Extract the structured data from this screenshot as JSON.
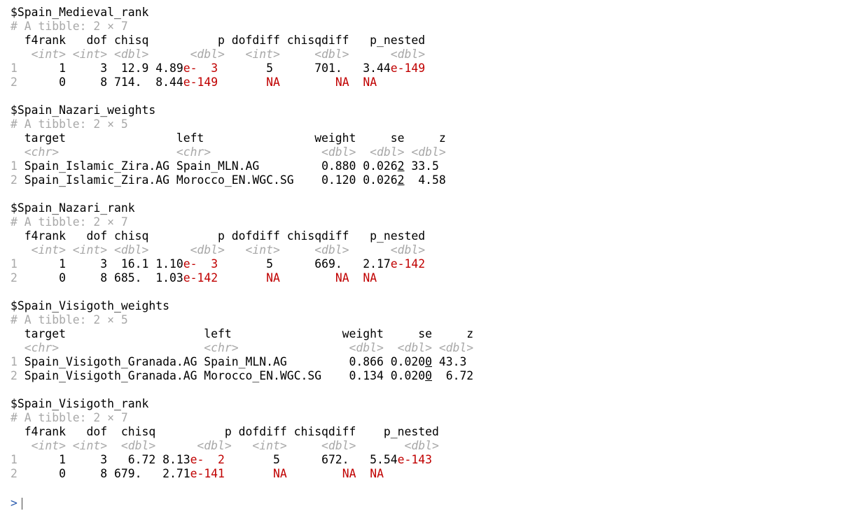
{
  "console": {
    "lines": [
      [
        {
          "t": "$Spain_Medieval_rank",
          "k": "text"
        }
      ],
      [
        {
          "t": "# A tibble: 2 × 7",
          "k": "comment"
        }
      ],
      [
        {
          "t": "  f4rank   dof chisq          p dofdiff chisqdiff   p_nested",
          "k": "text"
        }
      ],
      [
        {
          "t": "   <int> <int> <dbl>      <dbl>   <int>     <dbl>      <dbl>",
          "k": "type"
        }
      ],
      [
        {
          "t": "1",
          "k": "rownum"
        },
        {
          "t": "      1     3  12.9 4.89",
          "k": "text"
        },
        {
          "t": "e-  3",
          "k": "red"
        },
        {
          "t": "       5      701.   3.44",
          "k": "text"
        },
        {
          "t": "e-149",
          "k": "red"
        }
      ],
      [
        {
          "t": "2",
          "k": "rownum"
        },
        {
          "t": "      0     8 714.  8.44",
          "k": "text"
        },
        {
          "t": "e-149",
          "k": "red"
        },
        {
          "t": "       ",
          "k": "text"
        },
        {
          "t": "NA",
          "k": "red"
        },
        {
          "t": "        ",
          "k": "text"
        },
        {
          "t": "NA",
          "k": "red"
        },
        {
          "t": "  ",
          "k": "text"
        },
        {
          "t": "NA",
          "k": "red"
        }
      ],
      [
        {
          "t": "",
          "k": "text"
        }
      ],
      [
        {
          "t": "$Spain_Nazari_weights",
          "k": "text"
        }
      ],
      [
        {
          "t": "# A tibble: 2 × 5",
          "k": "comment"
        }
      ],
      [
        {
          "t": "  target                left                weight     se     z",
          "k": "text"
        }
      ],
      [
        {
          "t": "  <chr>                 <chr>                <dbl>  <dbl> <dbl>",
          "k": "type"
        }
      ],
      [
        {
          "t": "1",
          "k": "rownum"
        },
        {
          "t": " Spain_Islamic_Zira.AG Spain_MLN.AG         0.880 0.026",
          "k": "text"
        },
        {
          "t": "2",
          "k": "under"
        },
        {
          "t": " 33.5",
          "k": "text"
        }
      ],
      [
        {
          "t": "2",
          "k": "rownum"
        },
        {
          "t": " Spain_Islamic_Zira.AG Morocco_EN.WGC.SG    0.120 0.026",
          "k": "text"
        },
        {
          "t": "2",
          "k": "under"
        },
        {
          "t": "  4.58",
          "k": "text"
        }
      ],
      [
        {
          "t": "",
          "k": "text"
        }
      ],
      [
        {
          "t": "$Spain_Nazari_rank",
          "k": "text"
        }
      ],
      [
        {
          "t": "# A tibble: 2 × 7",
          "k": "comment"
        }
      ],
      [
        {
          "t": "  f4rank   dof chisq          p dofdiff chisqdiff   p_nested",
          "k": "text"
        }
      ],
      [
        {
          "t": "   <int> <int> <dbl>      <dbl>   <int>     <dbl>      <dbl>",
          "k": "type"
        }
      ],
      [
        {
          "t": "1",
          "k": "rownum"
        },
        {
          "t": "      1     3  16.1 1.10",
          "k": "text"
        },
        {
          "t": "e-  3",
          "k": "red"
        },
        {
          "t": "       5      669.   2.17",
          "k": "text"
        },
        {
          "t": "e-142",
          "k": "red"
        }
      ],
      [
        {
          "t": "2",
          "k": "rownum"
        },
        {
          "t": "      0     8 685.  1.03",
          "k": "text"
        },
        {
          "t": "e-142",
          "k": "red"
        },
        {
          "t": "       ",
          "k": "text"
        },
        {
          "t": "NA",
          "k": "red"
        },
        {
          "t": "        ",
          "k": "text"
        },
        {
          "t": "NA",
          "k": "red"
        },
        {
          "t": "  ",
          "k": "text"
        },
        {
          "t": "NA",
          "k": "red"
        }
      ],
      [
        {
          "t": "",
          "k": "text"
        }
      ],
      [
        {
          "t": "$Spain_Visigoth_weights",
          "k": "text"
        }
      ],
      [
        {
          "t": "# A tibble: 2 × 5",
          "k": "comment"
        }
      ],
      [
        {
          "t": "  target                    left                weight     se     z",
          "k": "text"
        }
      ],
      [
        {
          "t": "  <chr>                     <chr>                <dbl>  <dbl> <dbl>",
          "k": "type"
        }
      ],
      [
        {
          "t": "1",
          "k": "rownum"
        },
        {
          "t": " Spain_Visigoth_Granada.AG Spain_MLN.AG         0.866 0.020",
          "k": "text"
        },
        {
          "t": "0",
          "k": "under"
        },
        {
          "t": " 43.3",
          "k": "text"
        }
      ],
      [
        {
          "t": "2",
          "k": "rownum"
        },
        {
          "t": " Spain_Visigoth_Granada.AG Morocco_EN.WGC.SG    0.134 0.020",
          "k": "text"
        },
        {
          "t": "0",
          "k": "under"
        },
        {
          "t": "  6.72",
          "k": "text"
        }
      ],
      [
        {
          "t": "",
          "k": "text"
        }
      ],
      [
        {
          "t": "$Spain_Visigoth_rank",
          "k": "text"
        }
      ],
      [
        {
          "t": "# A tibble: 2 × 7",
          "k": "comment"
        }
      ],
      [
        {
          "t": "  f4rank   dof  chisq          p dofdiff chisqdiff    p_nested",
          "k": "text"
        }
      ],
      [
        {
          "t": "   <int> <int>  <dbl>      <dbl>   <int>     <dbl>       <dbl>",
          "k": "type"
        }
      ],
      [
        {
          "t": "1",
          "k": "rownum"
        },
        {
          "t": "      1     3   6.72 8.13",
          "k": "text"
        },
        {
          "t": "e-  2",
          "k": "red"
        },
        {
          "t": "       5      672.   5.54",
          "k": "text"
        },
        {
          "t": "e-143",
          "k": "red"
        }
      ],
      [
        {
          "t": "2",
          "k": "rownum"
        },
        {
          "t": "      0     8 679.   2.71",
          "k": "text"
        },
        {
          "t": "e-141",
          "k": "red"
        },
        {
          "t": "       ",
          "k": "text"
        },
        {
          "t": "NA",
          "k": "red"
        },
        {
          "t": "        ",
          "k": "text"
        },
        {
          "t": "NA",
          "k": "red"
        },
        {
          "t": "  ",
          "k": "text"
        },
        {
          "t": "NA",
          "k": "red"
        }
      ]
    ],
    "prompt": ">"
  }
}
